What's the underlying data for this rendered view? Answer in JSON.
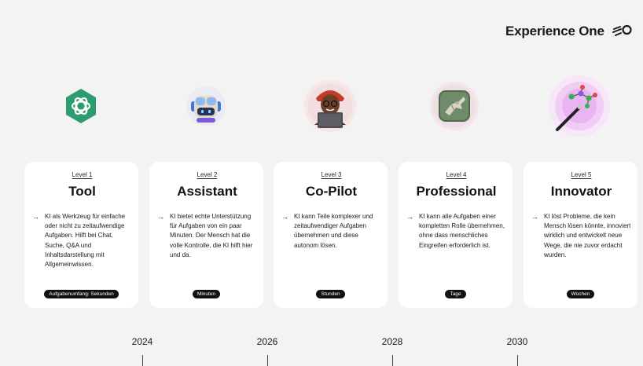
{
  "brand": {
    "name": "Experience One"
  },
  "levels": [
    {
      "level": "Level 1",
      "title": "Tool",
      "description": "KI als Werkzeug für einfache oder nicht zu zeitaufwendige Aufgaben. Hilft bei Chat, Suche, Q&A und Inhaltsdarstellung mit Allgemeinwissen.",
      "badge": "Aufgabenumfang: Sekunden",
      "icon": "chatgpt-logo-icon"
    },
    {
      "level": "Level 2",
      "title": "Assistant",
      "description": "KI bietet echte Unterstützung für Aufgaben von ein paar Minuten. Der Mensch hat die volle Kontrolle, die KI hilft hier und da.",
      "badge": "Minuten",
      "icon": "copilot-robot-icon"
    },
    {
      "level": "Level 3",
      "title": "Co-Pilot",
      "description": "KI kann Teile komplexer und zeitaufwendiger Aufgaben übernehmen und diese autonom lösen.",
      "badge": "Stunden",
      "icon": "person-laptop-avatar-icon"
    },
    {
      "level": "Level 4",
      "title": "Professional",
      "description": "KI kann alle Aufgaben einer kompletten Rolle übernehmen, ohne dass menschliches Eingreifen erforderlich ist.",
      "badge": "Tage",
      "icon": "robot-hand-icon"
    },
    {
      "level": "Level 5",
      "title": "Innovator",
      "description": "KI löst Probleme, die kein Mensch lösen könnte, innoviert wirklich und entwickelt neue Wege, die nie zuvor erdacht wurden.",
      "badge": "Wochen",
      "icon": "magic-wand-molecule-icon"
    }
  ],
  "arrow_glyph": "→",
  "timeline": {
    "years": [
      "2024",
      "2026",
      "2028",
      "2030"
    ]
  },
  "colors": {
    "background": "#f3f3f4",
    "card": "#ffffff",
    "badge": "#111111",
    "chatgpt_green": "#2d9c6e",
    "glow_purple": "#d27af0"
  }
}
